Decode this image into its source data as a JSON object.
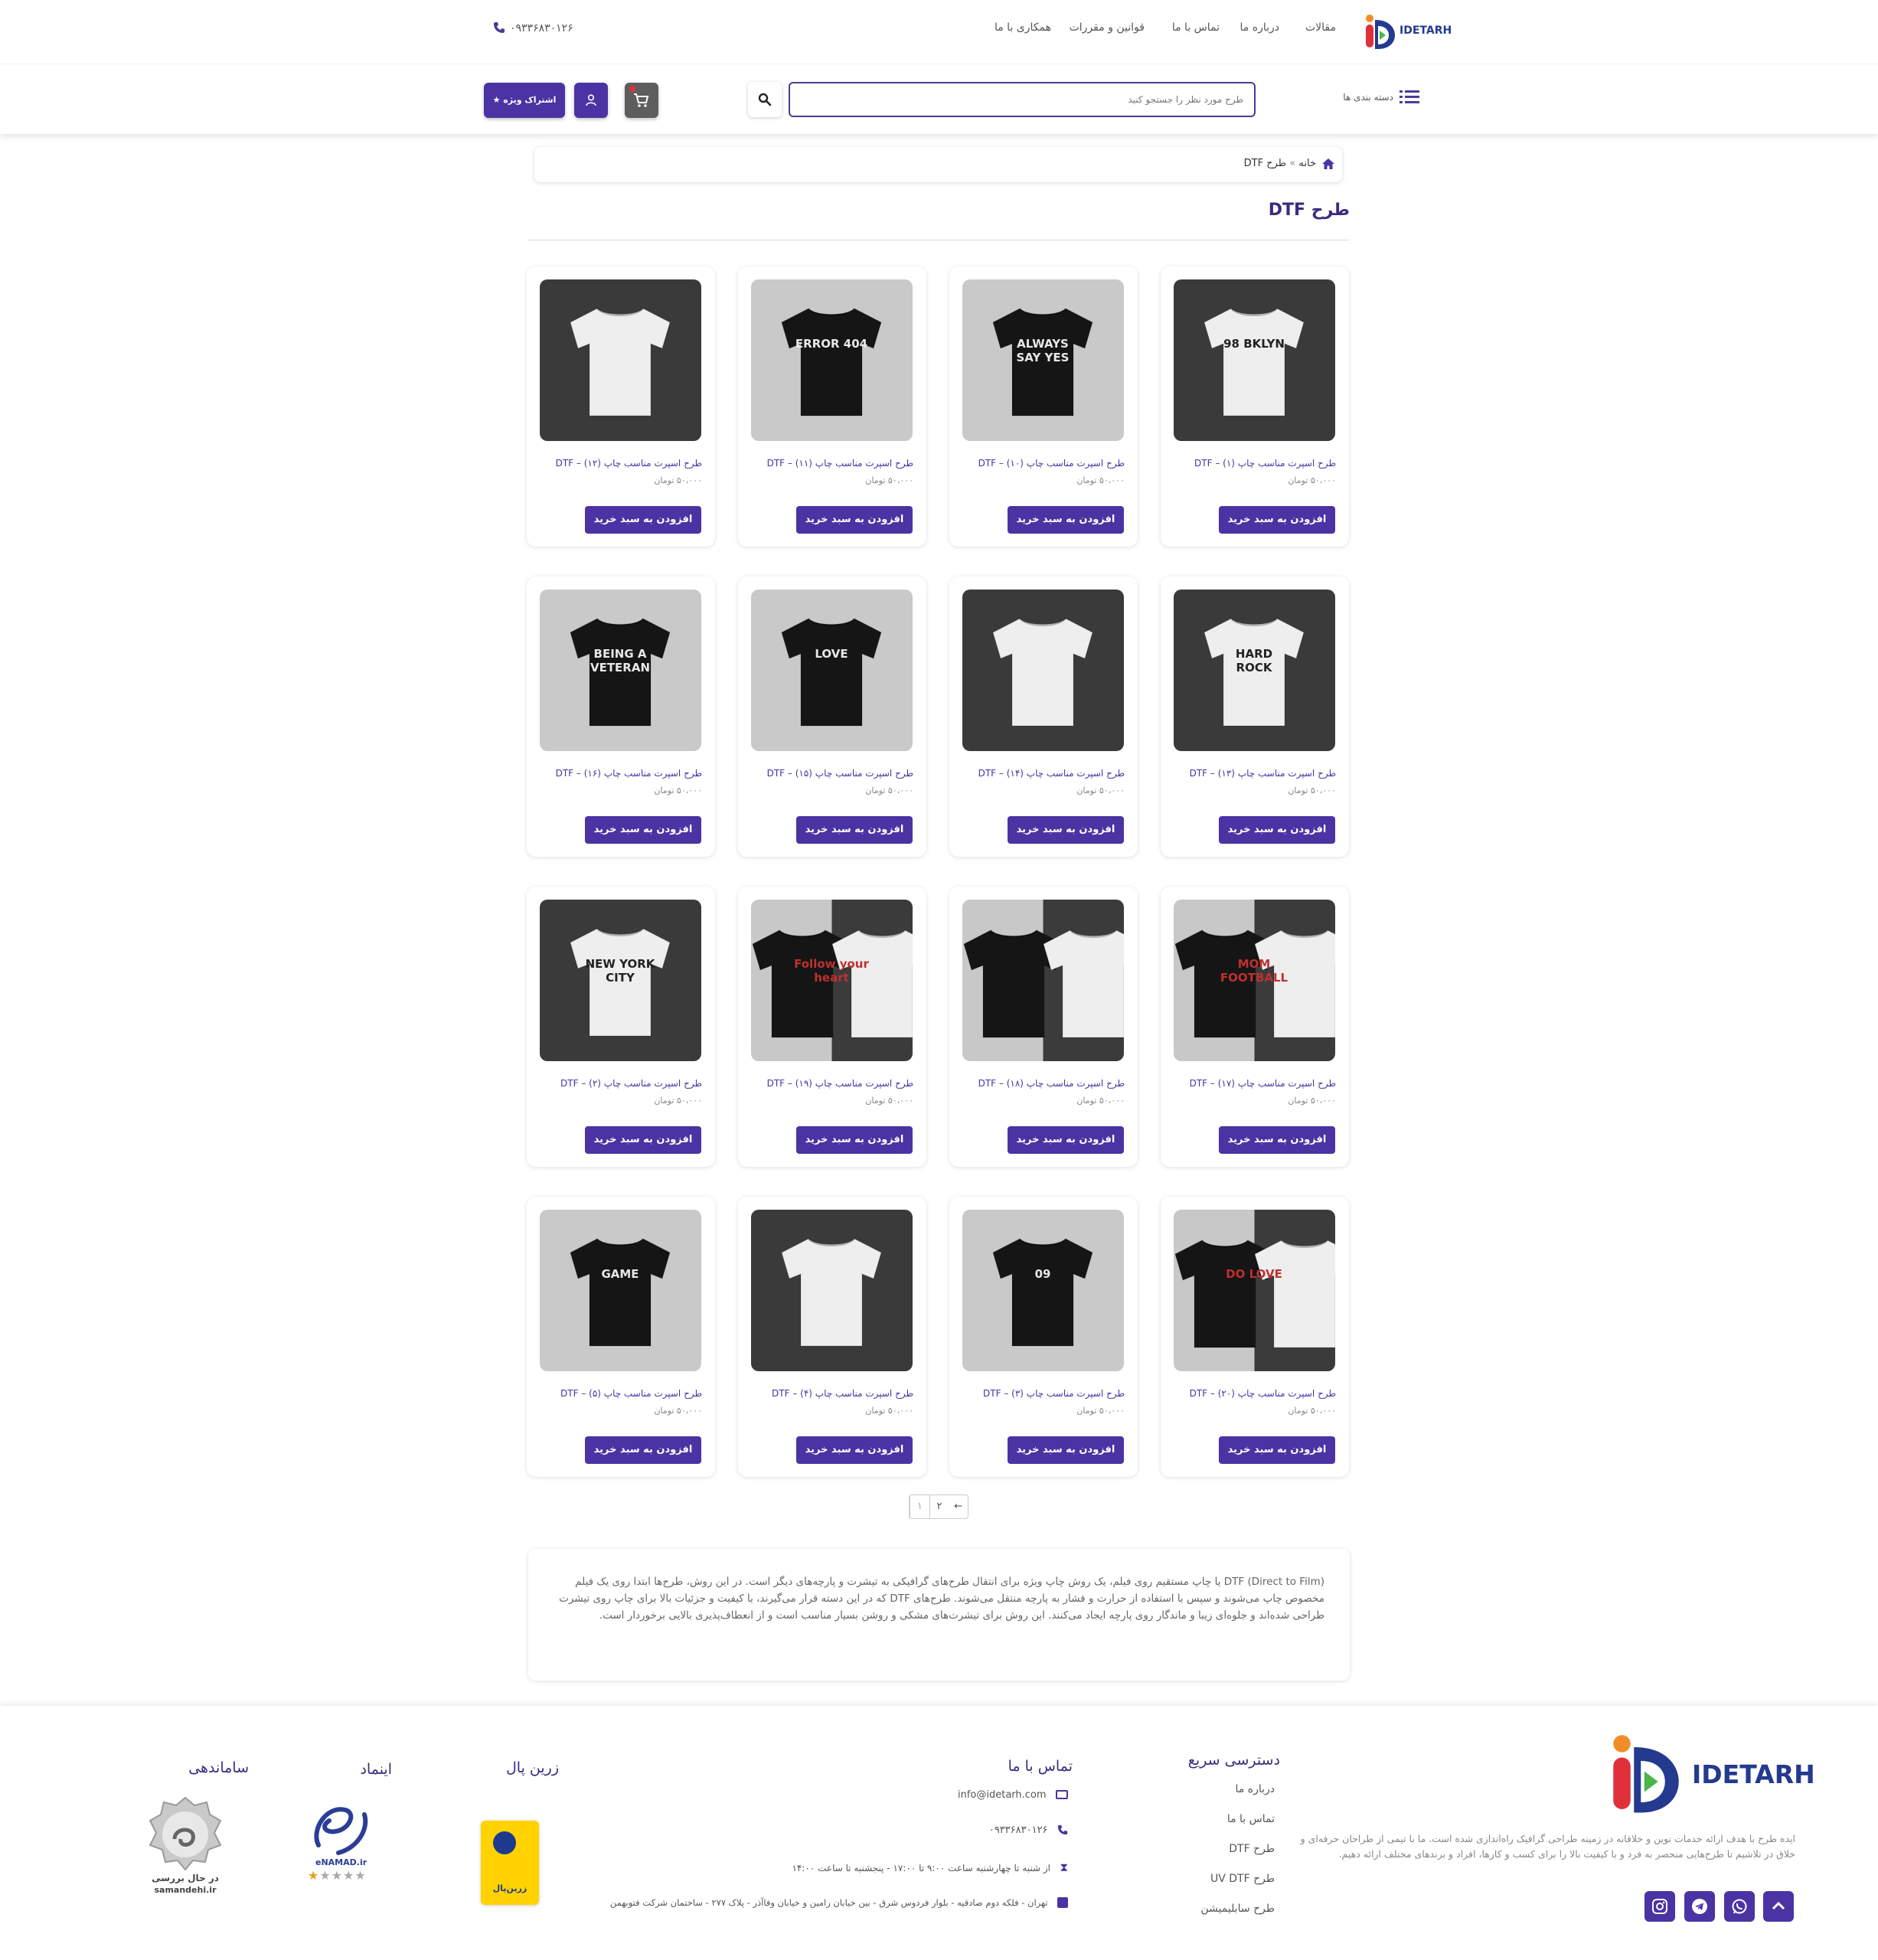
{
  "header": {
    "brand": "IDETARH",
    "nav": [
      "مقالات",
      "درباره ما",
      "تماس با ما",
      "قوانین و مقررات",
      "همکاری با ما"
    ],
    "phone": "۰۹۳۳۶۸۳۰۱۲۶",
    "categories_label": "دسته بندی ها",
    "search_placeholder": "طرح مورد نظر را جستجو کنید",
    "vip_label": "اشتراک ویژه ★"
  },
  "breadcrumb": {
    "home": "خانه",
    "sep": "»",
    "current": "طرح DTF"
  },
  "page_title": "طرح DTF",
  "buy_label": "افزودن به سبد خرید",
  "products": [
    {
      "name": "طرح اسپرت مناسب چاپ (۱) – DTF",
      "price": "۵۰،۰۰۰ تومان",
      "shirt": "white",
      "bg": "dark",
      "art": "98 BKLYN"
    },
    {
      "name": "طرح اسپرت مناسب چاپ (۱۰) – DTF",
      "price": "۵۰،۰۰۰ تومان",
      "shirt": "black",
      "bg": "light",
      "art": "ALWAYS SAY YES"
    },
    {
      "name": "طرح اسپرت مناسب چاپ (۱۱) – DTF",
      "price": "۵۰،۰۰۰ تومان",
      "shirt": "black",
      "bg": "light",
      "art": "ERROR 404"
    },
    {
      "name": "طرح اسپرت مناسب چاپ (۱۲) – DTF",
      "price": "۵۰،۰۰۰ تومان",
      "shirt": "white",
      "bg": "dark",
      "art": ""
    },
    {
      "name": "طرح اسپرت مناسب چاپ (۱۳) – DTF",
      "price": "۵۰،۰۰۰ تومان",
      "shirt": "white",
      "bg": "dark",
      "art": "HARD ROCK"
    },
    {
      "name": "طرح اسپرت مناسب چاپ (۱۴) – DTF",
      "price": "۵۰،۰۰۰ تومان",
      "shirt": "white",
      "bg": "dark",
      "art": ""
    },
    {
      "name": "طرح اسپرت مناسب چاپ (۱۵) – DTF",
      "price": "۵۰،۰۰۰ تومان",
      "shirt": "black",
      "bg": "light",
      "art": "LOVE"
    },
    {
      "name": "طرح اسپرت مناسب چاپ (۱۶) – DTF",
      "price": "۵۰،۰۰۰ تومان",
      "shirt": "black",
      "bg": "light",
      "art": "BEING A VETERAN"
    },
    {
      "name": "طرح اسپرت مناسب چاپ (۱۷) – DTF",
      "price": "۵۰،۰۰۰ تومان",
      "shirt": "split",
      "bg": "split",
      "art": "MOM FOOTBALL"
    },
    {
      "name": "طرح اسپرت مناسب چاپ (۱۸) – DTF",
      "price": "۵۰،۰۰۰ تومان",
      "shirt": "split",
      "bg": "split",
      "art": ""
    },
    {
      "name": "طرح اسپرت مناسب چاپ (۱۹) – DTF",
      "price": "۵۰،۰۰۰ تومان",
      "shirt": "split",
      "bg": "split",
      "art": "Follow your heart"
    },
    {
      "name": "طرح اسپرت مناسب چاپ (۲) – DTF",
      "price": "۵۰،۰۰۰ تومان",
      "shirt": "white",
      "bg": "dark",
      "art": "NEW YORK CITY"
    },
    {
      "name": "طرح اسپرت مناسب چاپ (۲۰) – DTF",
      "price": "۵۰،۰۰۰ تومان",
      "shirt": "split",
      "bg": "split",
      "art": "DO LOVE"
    },
    {
      "name": "طرح اسپرت مناسب چاپ (۳) – DTF",
      "price": "۵۰،۰۰۰ تومان",
      "shirt": "black",
      "bg": "light",
      "art": "09"
    },
    {
      "name": "طرح اسپرت مناسب چاپ (۴) – DTF",
      "price": "۵۰،۰۰۰ تومان",
      "shirt": "white",
      "bg": "dark",
      "art": ""
    },
    {
      "name": "طرح اسپرت مناسب چاپ (۵) – DTF",
      "price": "۵۰،۰۰۰ تومان",
      "shirt": "black",
      "bg": "light",
      "art": "GAME"
    }
  ],
  "pagination": {
    "pages": [
      "۱",
      "۲"
    ],
    "next": "←"
  },
  "description": "DTF (Direct to Film) یا چاپ مستقیم روی فیلم، یک روش چاپ ویژه برای انتقال طرح‌های گرافیکی به تیشرت و پارچه‌های دیگر است. در این روش، طرح‌ها ابتدا روی یک فیلم مخصوص چاپ می‌شوند و سپس با استفاده از حرارت و فشار به پارچه منتقل می‌شوند. طرح‌های DTF که در این دسته قرار می‌گیرند، با کیفیت و جزئیات بالا برای چاپ روی تیشرت طراحی شده‌اند و جلوه‌ای زیبا و ماندگار روی پارچه ایجاد می‌کنند. این روش برای تیشرت‌های مشکی و روشن بسیار مناسب است و از انعطاف‌پذیری بالایی برخوردار است.",
  "footer": {
    "brand": "IDETARH",
    "about": "ایده طرح با هدف ارائه خدمات نوین و خلاقانه در زمینه طراحی گرافیک راه‌اندازی شده است. ما با تیمی از طراحان حرفه‌ای و خلاق در تلاشیم تا طرح‌هایی منحصر به فرد و با کیفیت بالا را برای کسب و کارها، افراد و برندهای مختلف ارائه دهیم.",
    "quick_title": "دسترسی سریع",
    "quick_links": [
      "درباره ما",
      "تماس با ما",
      "طرح DTF",
      "طرح UV DTF",
      "طرح سابلیمیشن"
    ],
    "contact_title": "تماس با ما",
    "email": "info@idetarh.com",
    "phone": "۰۹۳۳۶۸۳۰۱۲۶",
    "hours": "از شنبه تا چهارشنبه ساعت ۹:۰۰ تا ۱۷:۰۰ - پنجشنبه تا ساعت ۱۴:۰۰",
    "address": "تهران - فلکه دوم صادقیه - بلوار فردوس شرق - بین خیابان رامین و خیابان وفاآذر - پلاک ۲۷۷ - ساختمان شرکت فتوبهمن",
    "zarinpal_title": "زرین پال",
    "zarinpal_text": "زرین‌پال",
    "enamad_title": "اینماد",
    "enamad_text": "eNAMAD.ir",
    "samandehi_title": "ساماندهی",
    "samandehi_text": "در حال بررسی",
    "samandehi_site": "samandehi.ir"
  },
  "colors": {
    "brand": "#4b33a3",
    "title": "#3c2b7d",
    "accent_red": "#e0303a"
  }
}
